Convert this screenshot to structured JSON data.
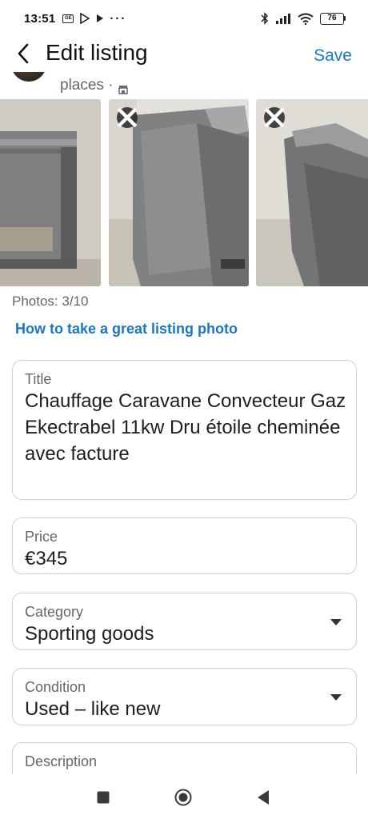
{
  "status_bar": {
    "time": "13:51",
    "notif_badge": "GE",
    "overflow": "···",
    "battery": "76"
  },
  "header": {
    "title": "Edit listing",
    "save_label": "Save"
  },
  "seller": {
    "subtitle": "places ·"
  },
  "photos": {
    "count_text": "Photos: 3/10",
    "tip_link": "How to take a great listing photo"
  },
  "form": {
    "title_label": "Title",
    "title_value": "Chauffage Caravane Convecteur Gaz  Ekectrabel 11kw Dru étoile cheminée avec facture",
    "price_label": "Price",
    "price_value": "€345",
    "category_label": "Category",
    "category_value": "Sporting goods",
    "condition_label": "Condition",
    "condition_value": "Used – like new",
    "description_label": "Description"
  },
  "colors": {
    "accent": "#1877c8",
    "field_border": "#cdd0d4",
    "secondary_text": "#65676b"
  }
}
